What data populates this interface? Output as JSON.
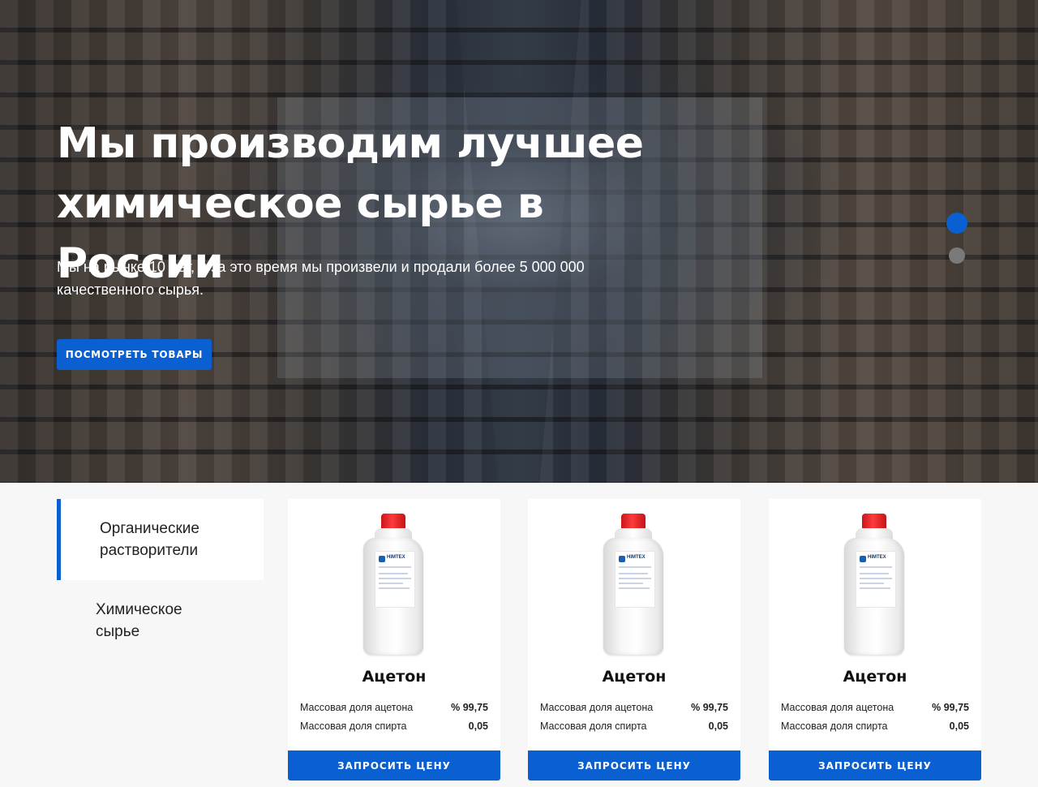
{
  "hero": {
    "title_line1": "Мы производим лучшее",
    "title_line2": "химическое сырье в России",
    "subtitle_line1": "Мы на рынке 10 лет, и за это время мы произвели и продали более 5 000 000",
    "subtitle_line2": "качественного сырья.",
    "cta_label": "ПОСМОТРЕТЬ ТОВАРЫ",
    "slides_total": 2,
    "active_slide": 1
  },
  "categories": [
    {
      "label_line1": "Органические",
      "label_line2": "растворители",
      "active": true
    },
    {
      "label_line1": "Химическое",
      "label_line2": "сырье",
      "active": false
    }
  ],
  "products": [
    {
      "name": "Ацетон",
      "bottle_brand": "HIMTEX",
      "specs": [
        {
          "name": "Массовая доля ацетона",
          "value": "% 99,75"
        },
        {
          "name": "Массовая доля спирта",
          "value": "0,05"
        }
      ],
      "button_label": "ЗАПРОСИТЬ ЦЕНУ"
    },
    {
      "name": "Ацетон",
      "bottle_brand": "HIMTEX",
      "specs": [
        {
          "name": "Массовая доля ацетона",
          "value": "% 99,75"
        },
        {
          "name": "Массовая доля спирта",
          "value": "0,05"
        }
      ],
      "button_label": "ЗАПРОСИТЬ ЦЕНУ"
    },
    {
      "name": "Ацетон",
      "bottle_brand": "HIMTEX",
      "specs": [
        {
          "name": "Массовая доля ацетона",
          "value": "% 99,75"
        },
        {
          "name": "Массовая доля спирта",
          "value": "0,05"
        }
      ],
      "button_label": "ЗАПРОСИТЬ ЦЕНУ"
    }
  ],
  "colors": {
    "accent": "#0a5fd1",
    "inactive_dot": "#7a7a7a",
    "cap_red": "#e82323"
  }
}
